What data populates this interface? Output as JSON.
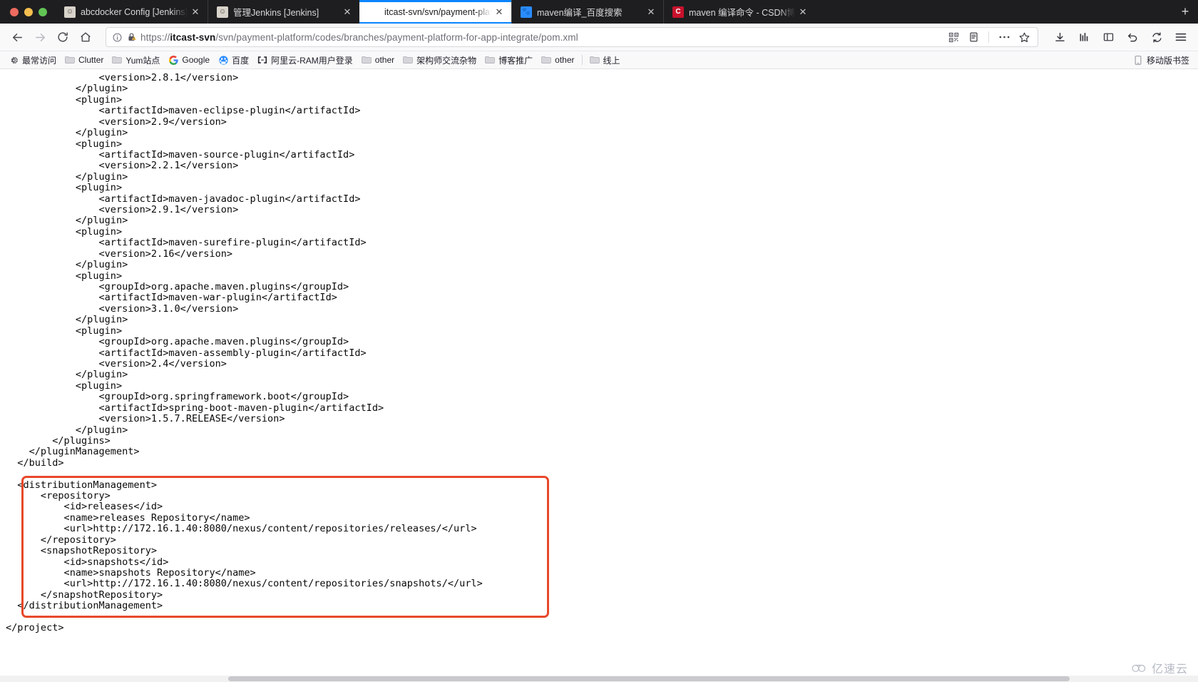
{
  "window": {
    "traffic_lights": [
      "close",
      "minimize",
      "zoom"
    ]
  },
  "tabs": [
    {
      "title": "abcdocker Config [Jenkins]",
      "favicon": "jenkins-icon",
      "active": false,
      "close_label": "✕"
    },
    {
      "title": "管理Jenkins [Jenkins]",
      "favicon": "jenkins-icon",
      "active": false,
      "close_label": "✕"
    },
    {
      "title": "itcast-svn/svn/payment-platform/co",
      "favicon": "none",
      "active": true,
      "close_label": "✕"
    },
    {
      "title": "maven编译_百度搜索",
      "favicon": "baidu-icon",
      "active": false,
      "close_label": "✕"
    },
    {
      "title": "maven 编译命令 - CSDN博客",
      "favicon": "csdn-icon",
      "active": false,
      "close_label": "✕"
    }
  ],
  "newtab_label": "+",
  "nav": {
    "back": "←",
    "forward": "→",
    "reload": "↻",
    "home": "⌂"
  },
  "urlbar": {
    "info_icon": "info-circle-icon",
    "lock_icon": "lock-warning-icon",
    "scheme": "https://",
    "host": "itcast-svn",
    "path": "/svn/payment-platform/codes/branches/payment-platform-for-app-integrate/pom.xml",
    "full_url": "https://itcast-svn/svn/payment-platform/codes/branches/payment-platform-for-app-integrate/pom.xml",
    "placeholder": "Search or enter address",
    "qr_icon": "qr-code-icon",
    "reader_icon": "reader-view-icon",
    "more_icon": "more-dots-icon",
    "bookmark_icon": "star-icon"
  },
  "toolbar_right": {
    "downloads": "downloads-arrow-icon",
    "library": "library-icon",
    "sidebar": "sidebar-icon",
    "undo": "undo-icon",
    "sync": "sync-icon",
    "menu": "hamburger-menu-icon"
  },
  "bookmarks": {
    "items": [
      {
        "label": "最常访问",
        "icon": "gear-icon"
      },
      {
        "label": "Clutter",
        "icon": "folder-icon"
      },
      {
        "label": "Yum站点",
        "icon": "folder-icon"
      },
      {
        "label": "Google",
        "icon": "google-icon"
      },
      {
        "label": "百度",
        "icon": "baidu-icon"
      },
      {
        "label": "阿里云-RAM用户登录",
        "icon": "aliyun-icon"
      },
      {
        "label": "other",
        "icon": "folder-icon"
      },
      {
        "label": "架构师交流杂物",
        "icon": "folder-icon"
      },
      {
        "label": "博客推广",
        "icon": "folder-icon"
      },
      {
        "label": "other",
        "icon": "folder-icon"
      },
      {
        "label": "线上",
        "icon": "folder-icon"
      }
    ],
    "mobile": {
      "label": "移动版书签",
      "icon": "mobile-icon"
    }
  },
  "content": {
    "code": "                <version>2.8.1</version>\n            </plugin>\n            <plugin>\n                <artifactId>maven-eclipse-plugin</artifactId>\n                <version>2.9</version>\n            </plugin>\n            <plugin>\n                <artifactId>maven-source-plugin</artifactId>\n                <version>2.2.1</version>\n            </plugin>\n            <plugin>\n                <artifactId>maven-javadoc-plugin</artifactId>\n                <version>2.9.1</version>\n            </plugin>\n            <plugin>\n                <artifactId>maven-surefire-plugin</artifactId>\n                <version>2.16</version>\n            </plugin>\n            <plugin>\n                <groupId>org.apache.maven.plugins</groupId>\n                <artifactId>maven-war-plugin</artifactId>\n                <version>3.1.0</version>\n            </plugin>\n            <plugin>\n                <groupId>org.apache.maven.plugins</groupId>\n                <artifactId>maven-assembly-plugin</artifactId>\n                <version>2.4</version>\n            </plugin>\n            <plugin>\n                <groupId>org.springframework.boot</groupId>\n                <artifactId>spring-boot-maven-plugin</artifactId>\n                <version>1.5.7.RELEASE</version>\n            </plugin>\n        </plugins>\n    </pluginManagement>\n  </build>\n\n  <distributionManagement>\n      <repository>\n          <id>releases</id>\n          <name>releases Repository</name>\n          <url>http://172.16.1.40:8080/nexus/content/repositories/releases/</url>\n      </repository>\n      <snapshotRepository>\n          <id>snapshots</id>\n          <name>snapshots Repository</name>\n          <url>http://172.16.1.40:8080/nexus/content/repositories/snapshots/</url>\n      </snapshotRepository>\n  </distributionManagement>\n\n</project>",
    "highlight_color": "#e8482a",
    "watermark": "亿速云"
  }
}
